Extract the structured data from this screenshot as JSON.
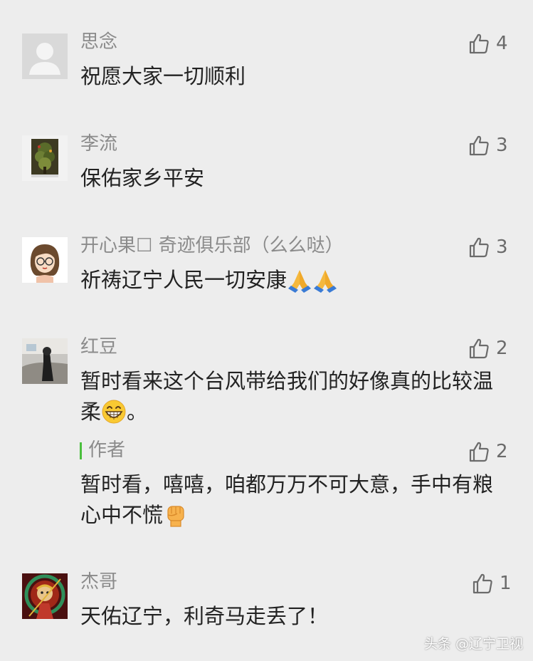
{
  "comments": [
    {
      "name": "思念",
      "text": "祝愿大家一切顺利",
      "likes": "4"
    },
    {
      "name": "李流",
      "text": "保佑家乡平安",
      "likes": "3"
    },
    {
      "name": "开心果☐ 奇迹俱乐部（么么哒）",
      "text": "祈祷辽宁人民一切安康",
      "emoji": "🙏🙏",
      "likes": "3"
    },
    {
      "name": "红豆",
      "text": "暂时看来这个台风带给我们的好像真的比较温柔",
      "text_tail": "。",
      "emoji": "😁",
      "likes": "2",
      "reply": {
        "name": "作者",
        "text": "暂时看，嘻嘻，咱都万万不可大意，手中有粮心中不慌",
        "emoji": "✊",
        "likes": "2"
      }
    },
    {
      "name": "杰哥",
      "text": "天佑辽宁，利奇马走丢了！",
      "likes": "1"
    }
  ],
  "watermark": "头条 @辽宁卫视",
  "colors": {
    "background": "#ededed",
    "name": "#8b8b8b",
    "text": "#222222",
    "author_bar": "#4bbf3d"
  }
}
